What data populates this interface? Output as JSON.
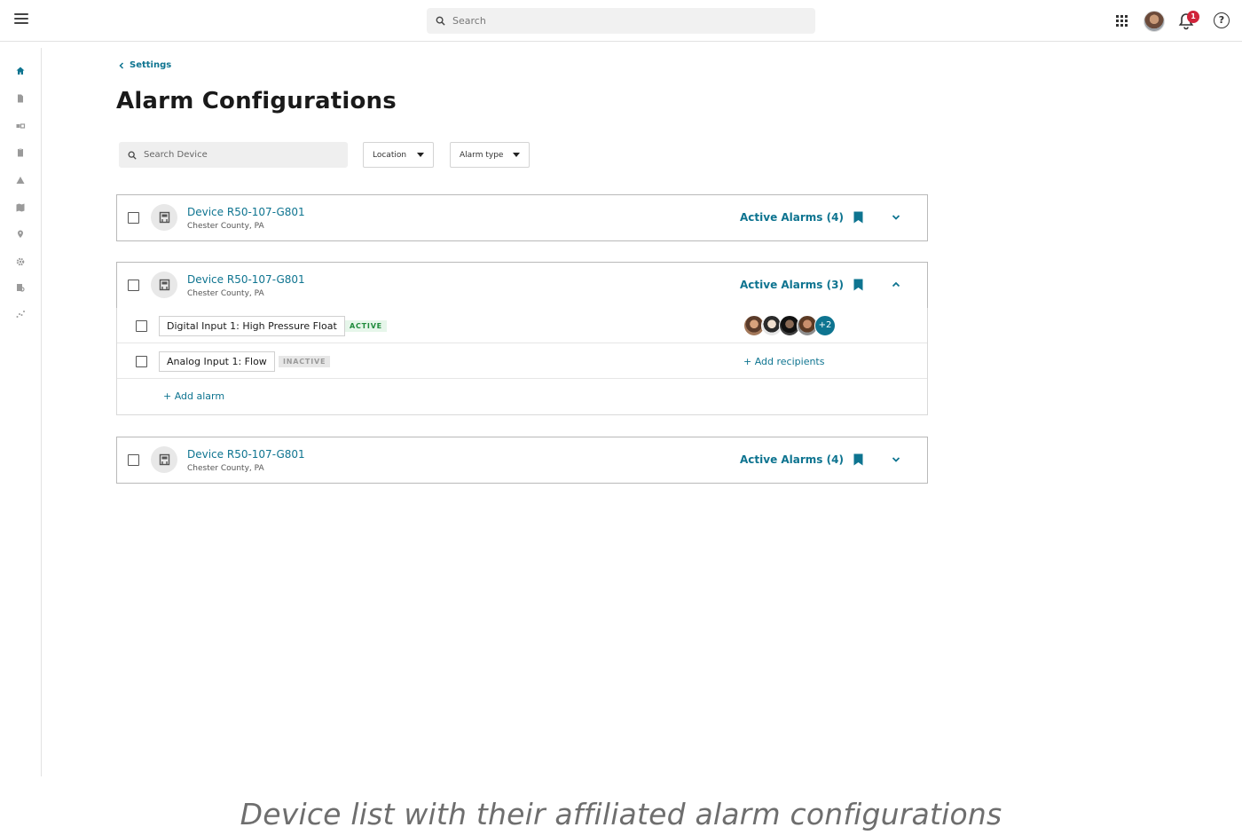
{
  "topbar": {
    "search_placeholder": "Search",
    "notification_count": "1",
    "help_glyph": "?"
  },
  "sidebar": {
    "icons": [
      "home-icon",
      "document-icon",
      "devices-icon",
      "clipboard-icon",
      "warning-icon",
      "map-icon",
      "location-pin-icon",
      "gear-icon",
      "report-icon",
      "analytics-icon"
    ]
  },
  "breadcrumb": {
    "label": "Settings"
  },
  "page": {
    "title": "Alarm Configurations"
  },
  "filters": {
    "search_placeholder": "Search Device",
    "location_label": "Location",
    "alarm_type_label": "Alarm type"
  },
  "devices": [
    {
      "name": "Device R50-107-G801",
      "location": "Chester County, PA",
      "alarms_label": "Active Alarms (4)",
      "expanded": false
    },
    {
      "name": "Device R50-107-G801",
      "location": "Chester County, PA",
      "alarms_label": "Active Alarms (3)",
      "expanded": true
    },
    {
      "name": "Device R50-107-G801",
      "location": "Chester County, PA",
      "alarms_label": "Active Alarms (4)",
      "expanded": false
    }
  ],
  "alarms": [
    {
      "label": "Digital Input 1: High Pressure Float",
      "status": "ACTIVE",
      "more_recipients": "+2"
    },
    {
      "label": "Analog Input 1: Flow",
      "status": "INACTIVE",
      "add_recipients_label": "+ Add recipients"
    }
  ],
  "add_alarm_label": "+ Add alarm",
  "caption": "Device list with their affiliated alarm configurations",
  "colors": {
    "accent": "#0e7490",
    "active_status": "#1f8a3b",
    "inactive_status": "#9a9a9a",
    "notification": "#d0243a"
  }
}
